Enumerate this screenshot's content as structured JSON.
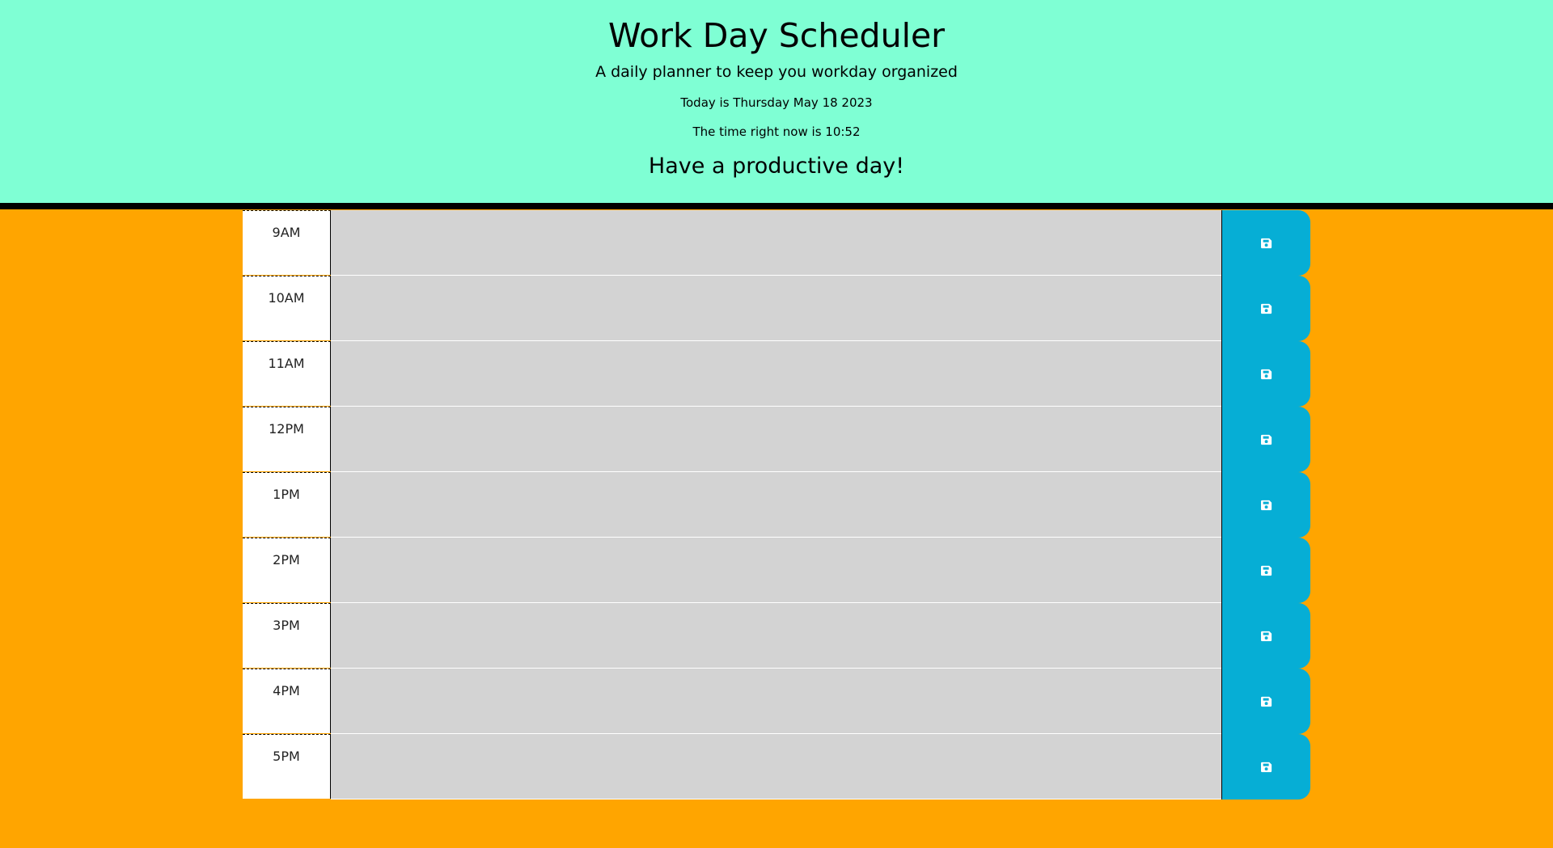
{
  "header": {
    "title": "Work Day Scheduler",
    "subtitle": "A daily planner to keep you workday organized",
    "today": "Today is Thursday May 18 2023",
    "time_now": "The time right now is 10:52",
    "motto": "Have a productive day!"
  },
  "colors": {
    "header_bg": "#7fffd4",
    "page_bg": "#ffa500",
    "textarea_bg": "#d3d3d3",
    "save_button": "#06aed5"
  },
  "schedule": {
    "rows": [
      {
        "hour": "9AM",
        "text": "",
        "save_icon": "floppy-disk-icon"
      },
      {
        "hour": "10AM",
        "text": "",
        "save_icon": "floppy-disk-icon"
      },
      {
        "hour": "11AM",
        "text": "",
        "save_icon": "floppy-disk-icon"
      },
      {
        "hour": "12PM",
        "text": "",
        "save_icon": "floppy-disk-icon"
      },
      {
        "hour": "1PM",
        "text": "",
        "save_icon": "floppy-disk-icon"
      },
      {
        "hour": "2PM",
        "text": "",
        "save_icon": "floppy-disk-icon"
      },
      {
        "hour": "3PM",
        "text": "",
        "save_icon": "floppy-disk-icon"
      },
      {
        "hour": "4PM",
        "text": "",
        "save_icon": "floppy-disk-icon"
      },
      {
        "hour": "5PM",
        "text": "",
        "save_icon": "floppy-disk-icon"
      }
    ]
  }
}
